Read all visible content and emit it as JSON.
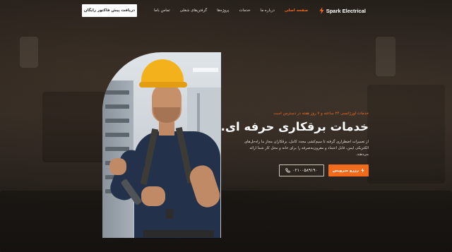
{
  "navbar": {
    "brand": "Spark Electrical",
    "cta_label": "دریافت پیش فاکتور رایگان",
    "links": [
      {
        "label": "صفحه اصلی",
        "active": true
      },
      {
        "label": "درباره ما",
        "active": false
      },
      {
        "label": "خدمات",
        "active": false
      },
      {
        "label": "پروژه‌ها",
        "active": false
      },
      {
        "label": "گرفتن‌های شغلی",
        "active": false
      },
      {
        "label": "تماس باما",
        "active": false
      }
    ]
  },
  "hero": {
    "kicker": "خدمات اورژانسی ۲۴ ساعته و ۷ روز هفته در دسترس است",
    "headline": "خدمات برقکاری حرفه ای.",
    "description": "از تعمیرات اضطراری گرفته تا سیم‌کشی مجدد کامل، برقکاران مجاز ما راه‌حل‌های الکتریکی ایمن، قابل اعتماد و مقرون‌به‌صرفه را برای خانه و محل کار شما ارائه می‌دهند.",
    "phone_label": "۰۲۱۰۰۵۸۹۱۹۰",
    "service_label": "رزرو سرویس"
  },
  "colors": {
    "accent": "#f26b1d",
    "text": "#ffffff",
    "background": "#2a241f"
  },
  "icons": {
    "brand": "bolt-icon",
    "phone": "phone-icon",
    "service": "bolt-icon"
  }
}
